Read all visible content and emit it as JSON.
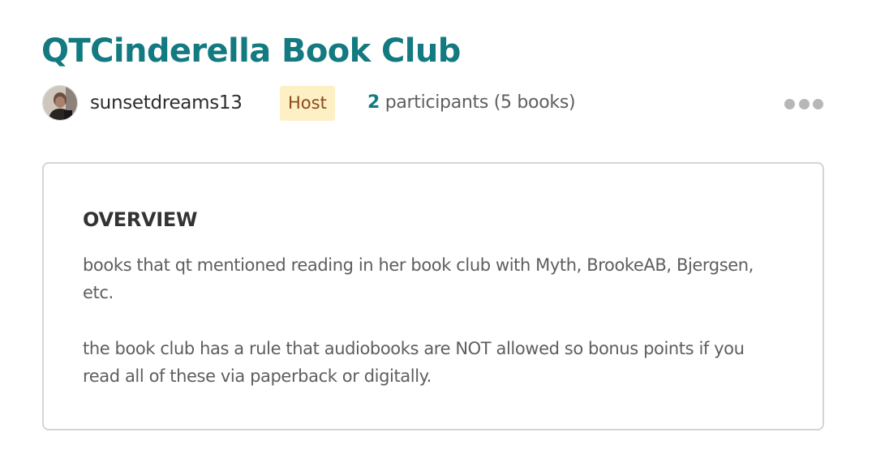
{
  "page": {
    "title": "QTCinderella Book Club"
  },
  "host": {
    "avatar_icon": "user-avatar-photo",
    "username": "sunsetdreams13",
    "badge": "Host"
  },
  "stats": {
    "participant_count": "2",
    "participants_text": " participants (5 books)"
  },
  "actions": {
    "more_icon": "more-horizontal-icon"
  },
  "overview": {
    "heading": "OVERVIEW",
    "paragraphs": [
      "books that qt mentioned reading in her book club with Myth, BrookeAB, Bjergsen, etc.",
      "the book club has a rule that audiobooks are NOT allowed so bonus points if you read all of these via paperback or digitally."
    ]
  },
  "colors": {
    "title": "#127a80",
    "badge_bg": "#fcf0c4",
    "badge_text": "#8a4a1c",
    "accent_count": "#127a80",
    "card_border": "#d4d4d4",
    "body_text": "#5e5e5e"
  }
}
